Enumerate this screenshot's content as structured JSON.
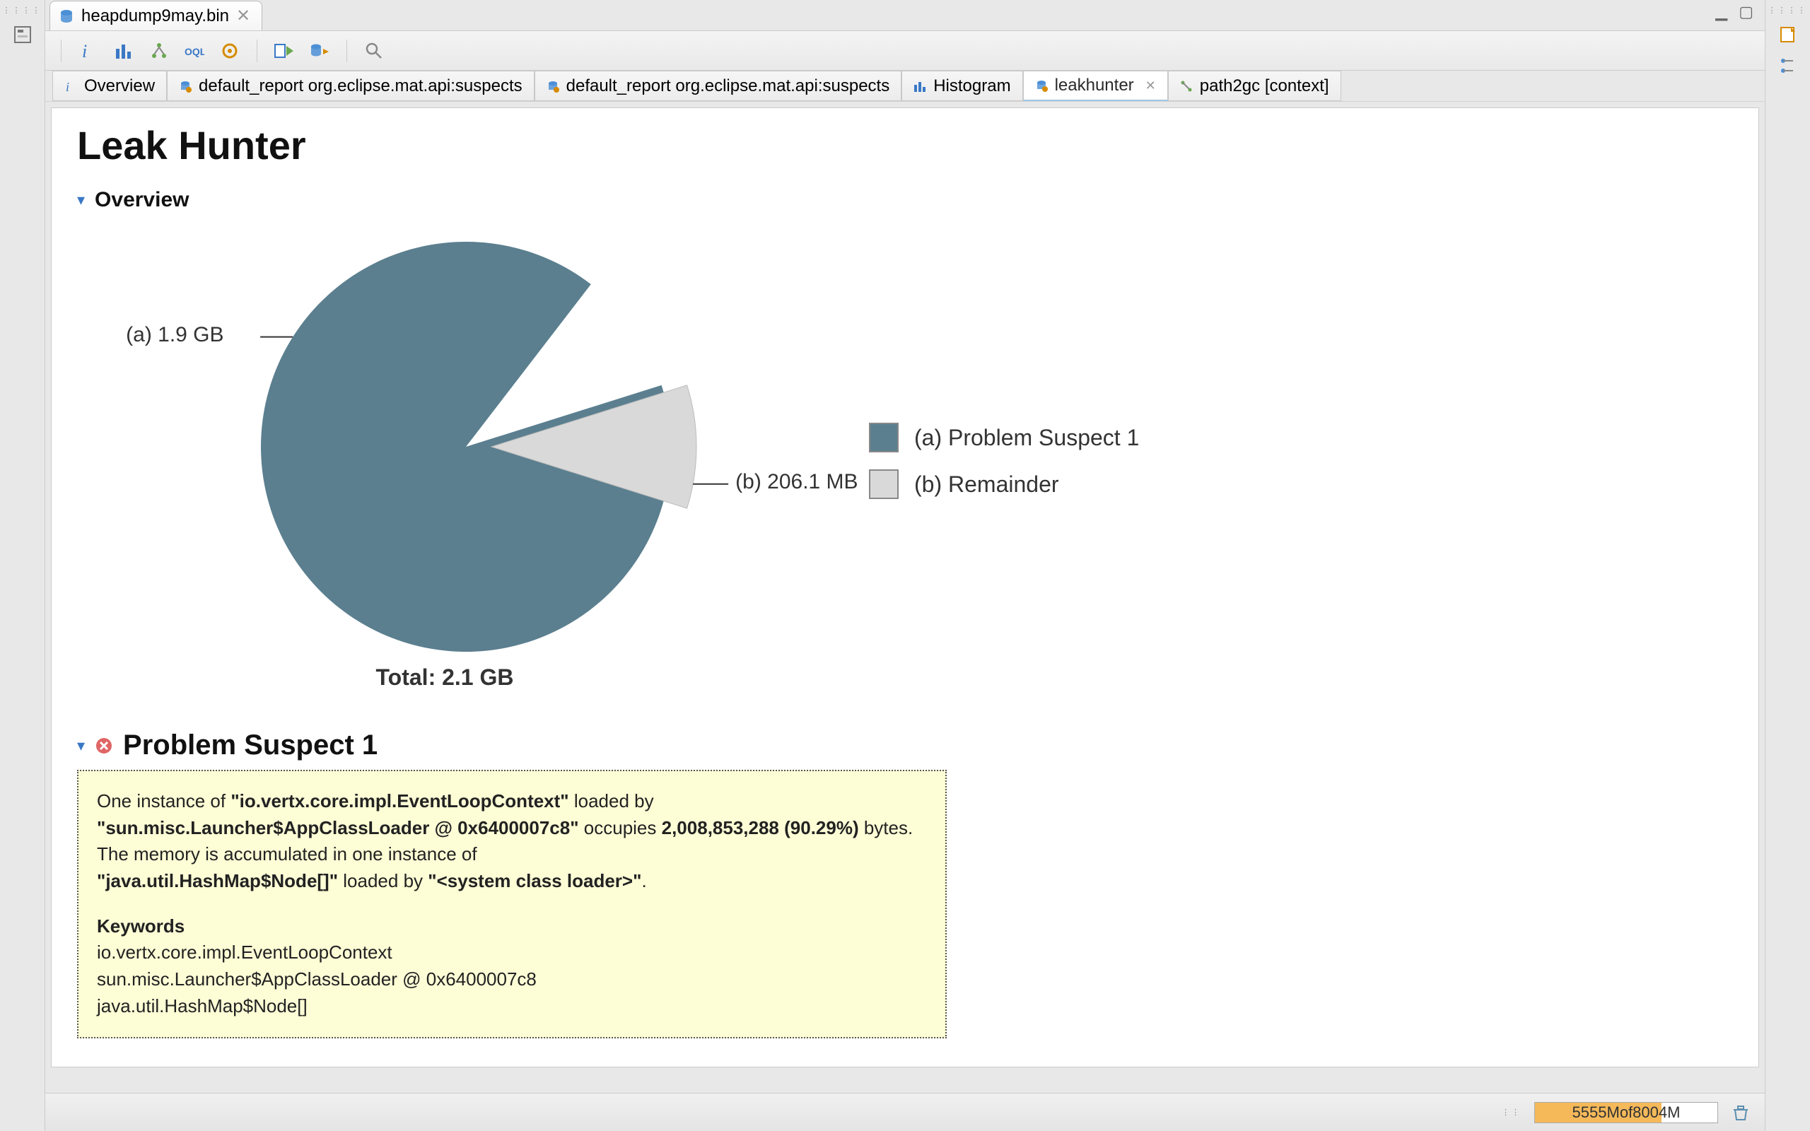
{
  "editor_tab": {
    "label": "heapdump9may.bin"
  },
  "window_controls": {
    "minimize": "▁",
    "maximize": "▢"
  },
  "subtabs": [
    {
      "icon": "info",
      "label": "Overview"
    },
    {
      "icon": "report",
      "label": "default_report  org.eclipse.mat.api:suspects"
    },
    {
      "icon": "report",
      "label": "default_report  org.eclipse.mat.api:suspects"
    },
    {
      "icon": "histogram",
      "label": "Histogram"
    },
    {
      "icon": "report",
      "label": "leakhunter",
      "active": true
    },
    {
      "icon": "tree",
      "label": "path2gc [context]"
    }
  ],
  "page": {
    "title": "Leak Hunter",
    "overview_heading": "Overview",
    "suspect_heading": "Problem Suspect 1"
  },
  "chart_data": {
    "type": "pie",
    "title": "",
    "total_label": "Total: 2.1 GB",
    "series": [
      {
        "key": "a",
        "name": "Problem Suspect 1",
        "label": "(a)  1.9 GB",
        "value_bytes": 2008853288,
        "fraction": 0.9029,
        "color": "#5b7f8f"
      },
      {
        "key": "b",
        "name": "Remainder",
        "label": "(b)  206.1 MB",
        "value_bytes": 216100000,
        "fraction": 0.0971,
        "color": "#d9d9d9"
      }
    ],
    "legend": [
      {
        "swatch": "#5b7f8f",
        "label": "(a)  Problem Suspect 1"
      },
      {
        "swatch": "#d9d9d9",
        "label": "(b)  Remainder"
      }
    ]
  },
  "suspect": {
    "intro_1": "One instance of ",
    "intro_2": "\"io.vertx.core.impl.EventLoopContext\"",
    "intro_3": " loaded by ",
    "cl_1": "\"sun.misc.Launcher$AppClassLoader @ 0x6400007c8\"",
    "occ_1": " occupies ",
    "bytes": "2,008,853,288 (90.29%)",
    "occ_2": " bytes. The memory is accumulated in one instance of ",
    "hm": "\"java.util.HashMap$Node[]\"",
    "occ_3": " loaded by ",
    "scl": "\"<system class loader>\"",
    "end": ".",
    "kw_heading": "Keywords",
    "kw1": "io.vertx.core.impl.EventLoopContext",
    "kw2": "sun.misc.Launcher$AppClassLoader @ 0x6400007c8",
    "kw3": "java.util.HashMap$Node[]"
  },
  "status": {
    "memory_used": "5555M",
    "memory_of": " of ",
    "memory_total": "8004M",
    "memory_fraction": 0.694
  }
}
